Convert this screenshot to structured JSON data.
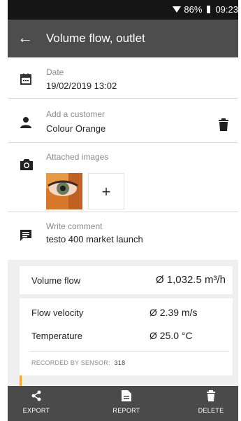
{
  "status_bar": {
    "battery": "86%",
    "time": "09:23"
  },
  "app_bar": {
    "title": "Volume flow, outlet"
  },
  "date": {
    "label": "Date",
    "value": "19/02/2019 13:02"
  },
  "customer": {
    "label": "Add a customer",
    "value": "Colour Orange"
  },
  "images": {
    "label": "Attached images",
    "add": "+"
  },
  "comment": {
    "label": "Write comment",
    "value": "testo 400 market launch"
  },
  "results": {
    "volume_flow": {
      "label": "Volume flow",
      "value": "Ø 1,032.5 m³/h"
    },
    "flow_velocity": {
      "label": "Flow velocity",
      "value": "Ø 2.39 m/s"
    },
    "temperature": {
      "label": "Temperature",
      "value": "Ø 25.0 °C"
    },
    "recorded_by": {
      "label": "RECORDED BY SENSOR:",
      "value": "318"
    }
  },
  "bottom_bar": {
    "export": "EXPORT",
    "report": "REPORT",
    "delete": "DELETE"
  },
  "colors": {
    "app_bar": "#4d4d4d",
    "status_bar": "#151515",
    "accent": "#f2a83a"
  },
  "icons": [
    "wifi-icon",
    "battery-icon",
    "back-arrow-icon",
    "calendar-icon",
    "person-icon",
    "trash-icon",
    "camera-icon",
    "plus-icon",
    "comment-icon",
    "share-icon",
    "document-icon",
    "delete-icon"
  ]
}
